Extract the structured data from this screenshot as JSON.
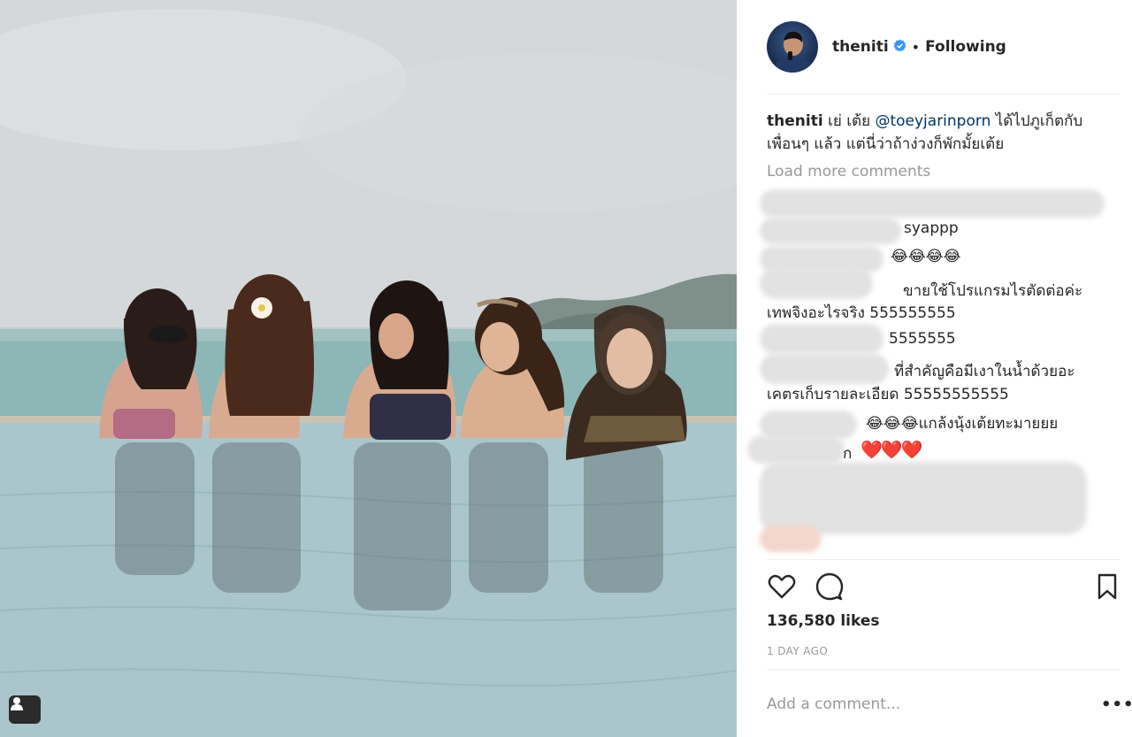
{
  "post": {
    "username": "theniti",
    "verified": true,
    "follow_status": "Following",
    "separator": "•",
    "caption_text": "เย่ เต้ย",
    "caption_mention": "@toeyjarinporn",
    "caption_rest": "ได้ไปภูเก็ตกับเพื่อนๆ แล้ว แต่นี่ว่าถ้าง่วงก็พักมั้ยเต้ย",
    "load_more": "Load more comments",
    "comments": [
      {
        "text": "syappp"
      },
      {
        "text": "😂😂😂😂"
      },
      {
        "text": "ขายใช้โปรแกรมไรตัดต่อค่ะ"
      },
      {
        "text": "เทพจิงอะไรจริง 555555555"
      },
      {
        "text": "5555555"
      },
      {
        "text": "ที่สำคัญคือมีเงาในน้ำด้วยอะ"
      },
      {
        "text": "เคตรเก็บรายละเอียด 55555555555"
      },
      {
        "text": "😂😂😂แกล้งนุ้งเต้ยทะมายยย"
      },
      {
        "text": "ก"
      },
      {
        "text": "❤️❤️❤️"
      }
    ],
    "likes": "136,580 likes",
    "time_ago": "1 DAY AGO",
    "add_comment_placeholder": "Add a comment...",
    "more_label": "•••"
  },
  "icons": {
    "like": "heart-icon",
    "comment": "comment-icon",
    "save": "bookmark-icon",
    "verified": "verified-badge-icon",
    "tags": "user-tag-icon"
  },
  "colors": {
    "verified": "#3897f0",
    "mention": "#003569",
    "secondary_text": "#999999",
    "heart": "#e0323c"
  }
}
